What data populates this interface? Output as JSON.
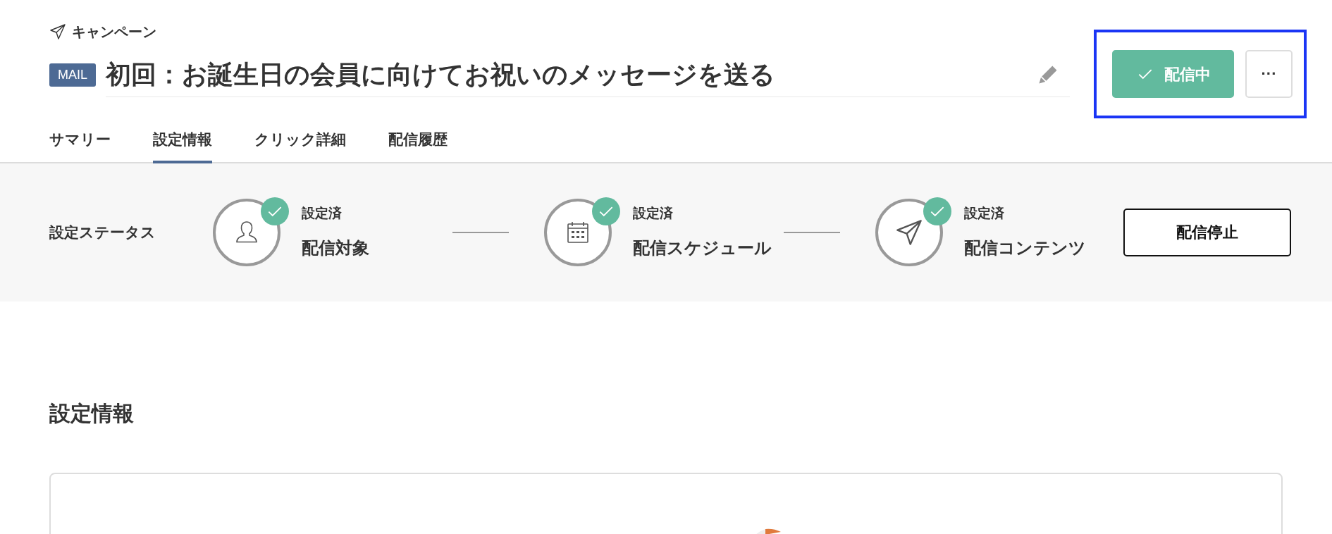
{
  "header": {
    "category": "キャンペーン",
    "channel_badge": "MAIL",
    "title": "初回：お誕生日の会員に向けてお祝いのメッセージを送る"
  },
  "status_button": {
    "label": "配信中",
    "active": true
  },
  "more_button": {
    "label": "···"
  },
  "tabs": [
    {
      "label": "サマリー",
      "selected": false
    },
    {
      "label": "設定情報",
      "selected": true
    },
    {
      "label": "クリック詳細",
      "selected": false
    },
    {
      "label": "配信履歴",
      "selected": false
    }
  ],
  "setting_status": {
    "label": "設定ステータス",
    "steps": [
      {
        "kind": "target",
        "state": "設定済",
        "name": "配信対象",
        "done": true
      },
      {
        "kind": "schedule",
        "state": "設定済",
        "name": "配信スケジュール",
        "done": true
      },
      {
        "kind": "content",
        "state": "設定済",
        "name": "配信コンテンツ",
        "done": true
      }
    ],
    "stop_button": "配信停止"
  },
  "section": {
    "title": "設定情報"
  }
}
